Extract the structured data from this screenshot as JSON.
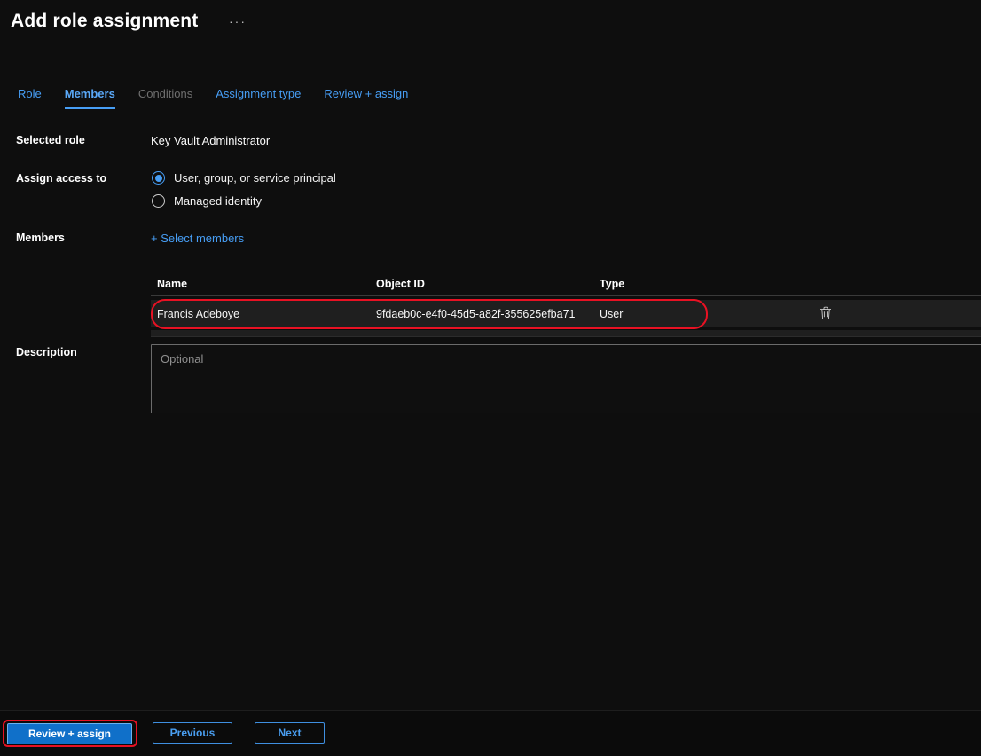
{
  "colors": {
    "accent_blue": "#479ef5",
    "annotation_red": "#e81123",
    "primary_button_bg": "#1070c9",
    "row_bg": "#1f1f1f",
    "page_bg": "#0e0e0e"
  },
  "header": {
    "title": "Add role assignment",
    "ellipsis": "···"
  },
  "tabs": {
    "items": [
      {
        "label": "Role",
        "state": "normal"
      },
      {
        "label": "Members",
        "state": "active"
      },
      {
        "label": "Conditions",
        "state": "disabled"
      },
      {
        "label": "Assignment type",
        "state": "normal"
      },
      {
        "label": "Review + assign",
        "state": "normal"
      }
    ]
  },
  "form": {
    "selected_role_label": "Selected role",
    "selected_role_value": "Key Vault Administrator",
    "assign_access_label": "Assign access to",
    "radio_user_label": "User, group, or service principal",
    "radio_managed_label": "Managed identity",
    "members_label": "Members",
    "select_members_link": "+ Select members",
    "table": {
      "col_name": "Name",
      "col_object_id": "Object ID",
      "col_type": "Type",
      "row": {
        "name": "Francis Adeboye",
        "object_id": "9fdaeb0c-e4f0-45d5-a82f-355625efba71",
        "type": "User"
      }
    },
    "description_label": "Description",
    "description_placeholder": "Optional"
  },
  "footer": {
    "review_assign_label": "Review + assign",
    "previous_label": "Previous",
    "next_label": "Next"
  }
}
